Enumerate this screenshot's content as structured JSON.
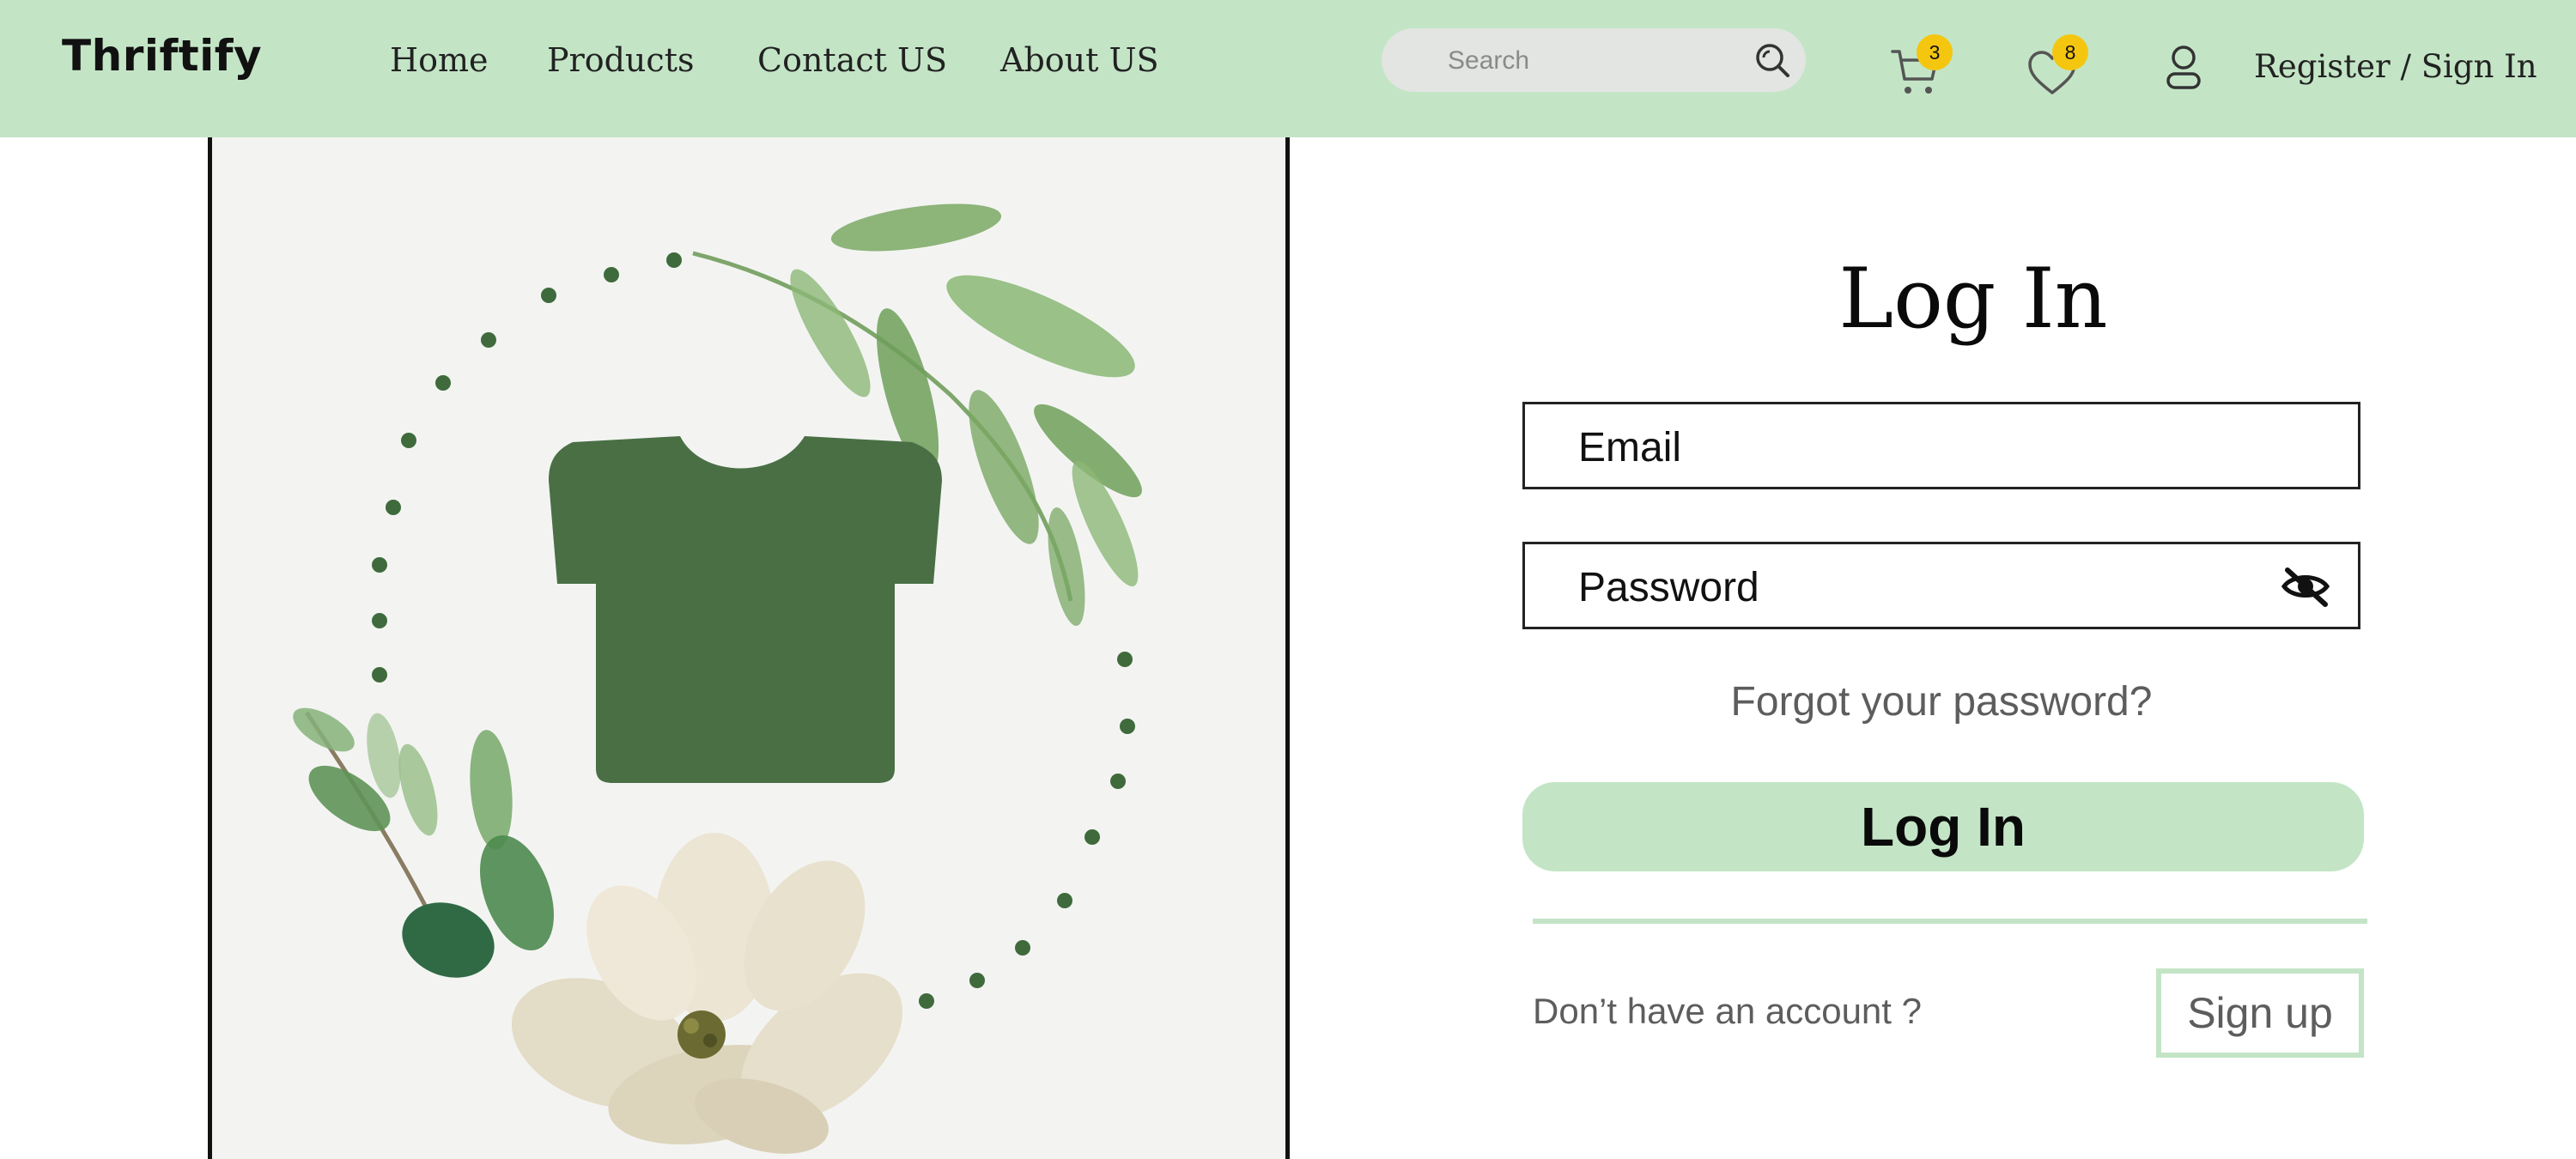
{
  "header": {
    "brand": "Thriftify",
    "nav": [
      {
        "label": "Home"
      },
      {
        "label": "Products"
      },
      {
        "label": "Contact US"
      },
      {
        "label": "About US"
      }
    ],
    "search": {
      "placeholder": "Search",
      "icon": "search-icon"
    },
    "cart": {
      "icon": "cart-icon",
      "count": "3"
    },
    "wishlist": {
      "icon": "heart-icon",
      "count": "8"
    },
    "account": {
      "icon": "user-icon"
    },
    "auth_link": "Register / Sign In"
  },
  "illustration": {
    "icons": [
      "t-shirt-icon",
      "leaf-branch",
      "flower"
    ]
  },
  "login": {
    "title": "Log In",
    "email_placeholder": "Email",
    "password_placeholder": "Password",
    "password_toggle_icon": "eye-slash-icon",
    "forgot": "Forgot your password?",
    "submit_label": "Log In",
    "no_account": "Don’t have an account ?",
    "signup_label": "Sign up"
  },
  "colors": {
    "header_bg": "#c3e5c6",
    "accent": "#c3e5c6",
    "shirt": "#4a6f45",
    "badge": "#f4c60f",
    "muted_text": "#5d5d5d"
  }
}
